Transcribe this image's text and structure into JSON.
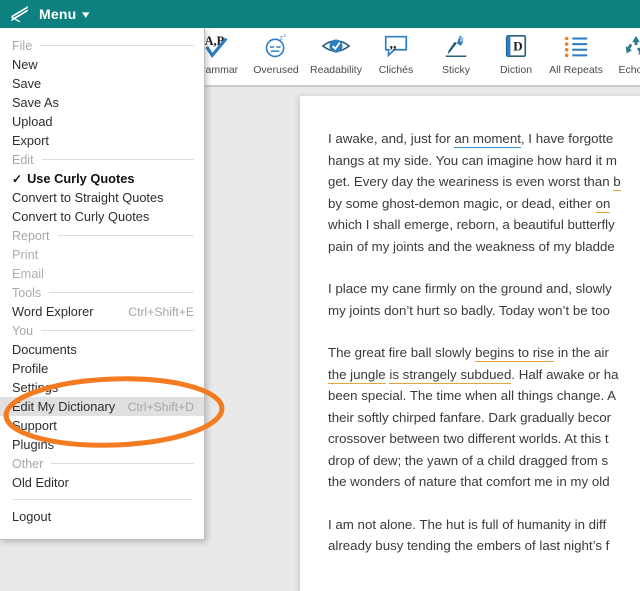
{
  "colors": {
    "brand_teal": "#0d8080",
    "annotation_orange": "#f47b20",
    "underline_blue": "#3c8dd6",
    "underline_orange": "#e8a33d",
    "workspace_grey": "#e9e9e9",
    "highlight_grey": "#e0e0e0"
  },
  "topbar": {
    "logo_icon": "stacked-pages-logo-icon",
    "menu_label": "Menu",
    "caret_icon": "chevron-down-icon"
  },
  "toolbar": {
    "items": [
      {
        "label": "Grammar",
        "icon": "grammar-check-icon"
      },
      {
        "label": "Overused",
        "icon": "sleepy-face-icon"
      },
      {
        "label": "Readability",
        "icon": "eye-check-icon"
      },
      {
        "label": "Clichés",
        "icon": "quote-bubble-icon"
      },
      {
        "label": "Sticky",
        "icon": "sticky-glue-icon"
      },
      {
        "label": "Diction",
        "icon": "dictionary-book-icon"
      },
      {
        "label": "All Repeats",
        "icon": "bulleted-list-icon"
      },
      {
        "label": "Echoes",
        "icon": "recycle-icon"
      }
    ]
  },
  "menu": {
    "entries": [
      {
        "type": "group",
        "label": "File"
      },
      {
        "type": "item",
        "label": "New"
      },
      {
        "type": "item",
        "label": "Save"
      },
      {
        "type": "item",
        "label": "Save As"
      },
      {
        "type": "item",
        "label": "Upload"
      },
      {
        "type": "item",
        "label": "Export"
      },
      {
        "type": "group",
        "label": "Edit"
      },
      {
        "type": "item",
        "label": "Use Curly Quotes",
        "checked": true,
        "check_glyph": "✓"
      },
      {
        "type": "item",
        "label": "Convert to Straight Quotes"
      },
      {
        "type": "item",
        "label": "Convert to Curly Quotes"
      },
      {
        "type": "group",
        "label": "Report"
      },
      {
        "type": "item",
        "label": "Print",
        "disabled": true
      },
      {
        "type": "item",
        "label": "Email",
        "disabled": true
      },
      {
        "type": "group",
        "label": "Tools"
      },
      {
        "type": "item",
        "label": "Word Explorer",
        "accel": "Ctrl+Shift+E"
      },
      {
        "type": "group",
        "label": "You"
      },
      {
        "type": "item",
        "label": "Documents"
      },
      {
        "type": "item",
        "label": "Profile"
      },
      {
        "type": "item",
        "label": "Settings"
      },
      {
        "type": "item",
        "label": "Edit My Dictionary",
        "accel": "Ctrl+Shift+D",
        "highlighted": true
      },
      {
        "type": "item",
        "label": "Support"
      },
      {
        "type": "item",
        "label": "Plugins"
      },
      {
        "type": "group",
        "label": "Other"
      },
      {
        "type": "item",
        "label": "Old Editor"
      },
      {
        "type": "divider"
      },
      {
        "type": "item",
        "label": "Logout"
      }
    ]
  },
  "document": {
    "paragraphs": [
      {
        "lines": [
          [
            {
              "t": "I awake, and, just for "
            },
            {
              "t": "an moment",
              "mark": "blue"
            },
            {
              "t": ", I have forgotte"
            }
          ],
          [
            {
              "t": "hangs at my side. You can imagine how hard it m"
            }
          ],
          [
            {
              "t": "get. Every day the weariness is even worst than "
            },
            {
              "t": "b",
              "mark": "orange"
            }
          ],
          [
            {
              "t": "by some ghost-demon magic, or dead, either "
            },
            {
              "t": "on",
              "mark": "orange"
            }
          ],
          [
            {
              "t": "which I shall emerge, reborn, a beautiful butterfly"
            }
          ],
          [
            {
              "t": "pain of my joints and the weakness of my bladde"
            }
          ]
        ]
      },
      {
        "lines": [
          [
            {
              "t": "I place my cane firmly on the ground and, slowly"
            }
          ],
          [
            {
              "t": "my joints don’t hurt so badly. Today won’t be too"
            }
          ]
        ]
      },
      {
        "lines": [
          [
            {
              "t": "The great fire ball slowly "
            },
            {
              "t": "begins to rise",
              "mark": "orange"
            },
            {
              "t": " in the air"
            }
          ],
          [
            {
              "t": "the jungle",
              "mark": "orange"
            },
            {
              "t": " "
            },
            {
              "t": "is strangely subdued",
              "mark": "orange"
            },
            {
              "t": ". Half awake or ha"
            }
          ],
          [
            {
              "t": "been special. The time when all things change. A"
            }
          ],
          [
            {
              "t": "their softly chirped fanfare. Dark gradually becor"
            }
          ],
          [
            {
              "t": "crossover between two different worlds. At this t"
            }
          ],
          [
            {
              "t": "drop of dew; the yawn of a child dragged from s"
            }
          ],
          [
            {
              "t": "the wonders of nature that comfort me in my old"
            }
          ]
        ]
      },
      {
        "lines": [
          [
            {
              "t": "I am not alone. The hut is full of humanity in diff"
            }
          ],
          [
            {
              "t": "already busy tending the embers of last night’s f"
            }
          ]
        ]
      }
    ]
  },
  "annotation": {
    "shape": "ellipse",
    "target_label": "Edit My Dictionary"
  }
}
